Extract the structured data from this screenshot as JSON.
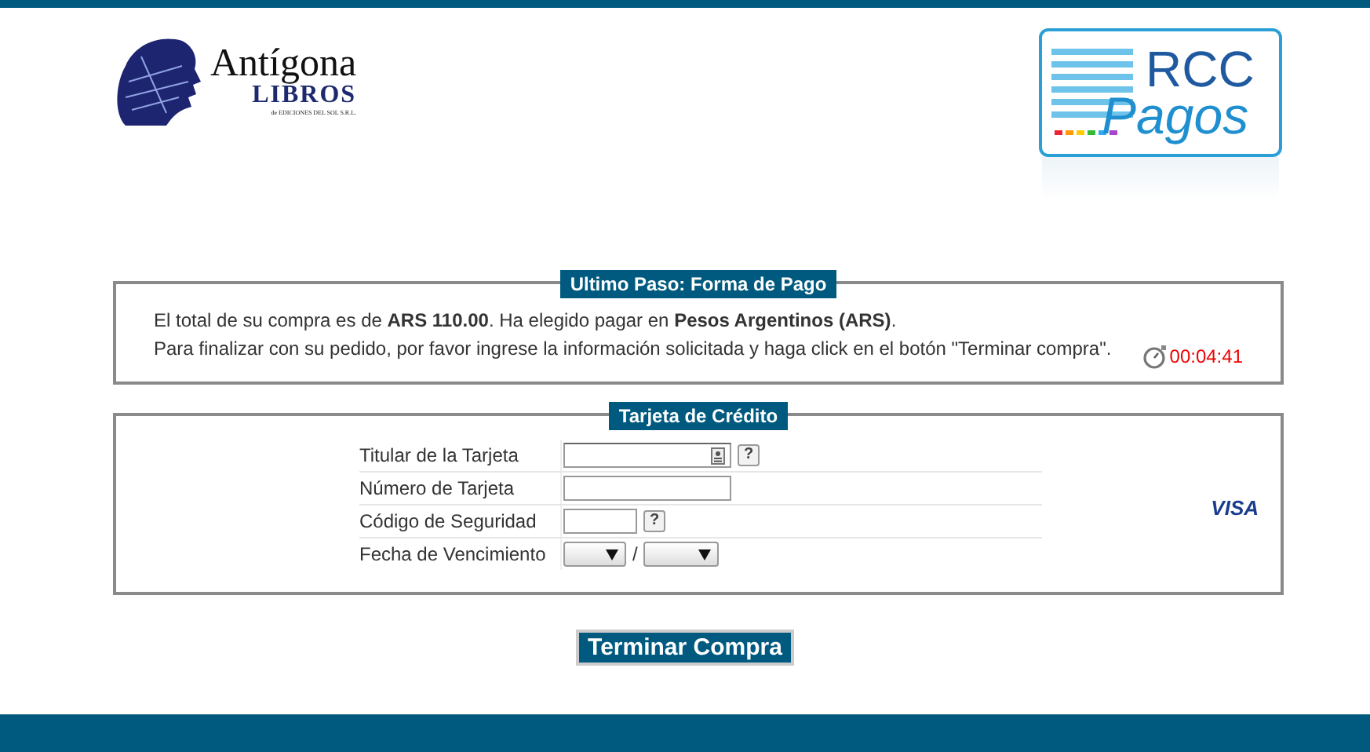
{
  "header": {
    "store_logo": {
      "name": "Antígona",
      "sub": "LIBROS",
      "tagline": "de EDICIONES DEL SOL S.R.L."
    },
    "gateway_logo": {
      "line1": "RCC",
      "line2": "Pagos"
    }
  },
  "summary": {
    "legend": "Ultimo Paso: Forma de Pago",
    "lines": [
      "El total de su compra es de **ARS 110.00**. Ha elegido pagar en **Pesos Argentinos (ARS)**.",
      "Para finalizar con su pedido, por favor ingrese la información solicitada y haga click en el botón \"Terminar compra\"."
    ],
    "timer": "00:04:41"
  },
  "card": {
    "legend": "Tarjeta de Crédito",
    "brand": "VISA",
    "fields": [
      {
        "label": "Titular de la Tarjeta",
        "kind": "holder",
        "help": "?"
      },
      {
        "label": "Número de Tarjeta",
        "kind": "number"
      },
      {
        "label": "Código de Seguridad",
        "kind": "code",
        "help": "?"
      },
      {
        "label": "Fecha de Vencimiento",
        "kind": "date",
        "separator": "/"
      }
    ]
  },
  "submit": {
    "label": "Terminar Compra"
  }
}
